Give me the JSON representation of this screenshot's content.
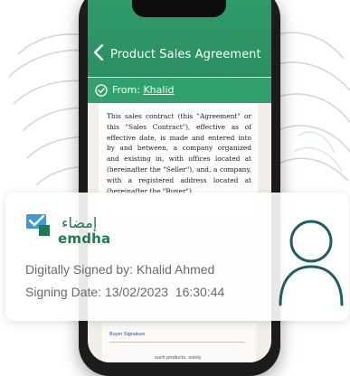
{
  "app": {
    "title": "Product Sales Agreement",
    "from_label": "From: ",
    "from_name": "Khalid"
  },
  "document": {
    "body": "This sales contract (this \"Agreement\" or this \"Sales Contract\"), effective as of effective date, is made and entered into by and between, a company organized and existing in, with offices located at (hereinafter the \"Seller\"), and, a company, with a registered address located at (hereinafter the \"Buyer\").",
    "buyer_signature_label": "Buyer Signature",
    "lower_snippet": "such products, solely"
  },
  "signature": {
    "logo_arabic": "إمضاء",
    "logo_english": "emdha",
    "signed_by": "Digitally Signed by: Khalid Ahmed",
    "signing_date_label": "Signing Date: ",
    "signing_date": "13/02/2023  16:30:44"
  },
  "colors": {
    "accent_green": "#2f9a6a",
    "emdha_green": "#1f7a4d",
    "avatar_outline": "#1e5e63"
  },
  "icons": {
    "back": "chevron-left-icon",
    "from": "check-circle-icon",
    "avatar": "user-avatar-icon",
    "logo": "emdha-logo-icon"
  }
}
